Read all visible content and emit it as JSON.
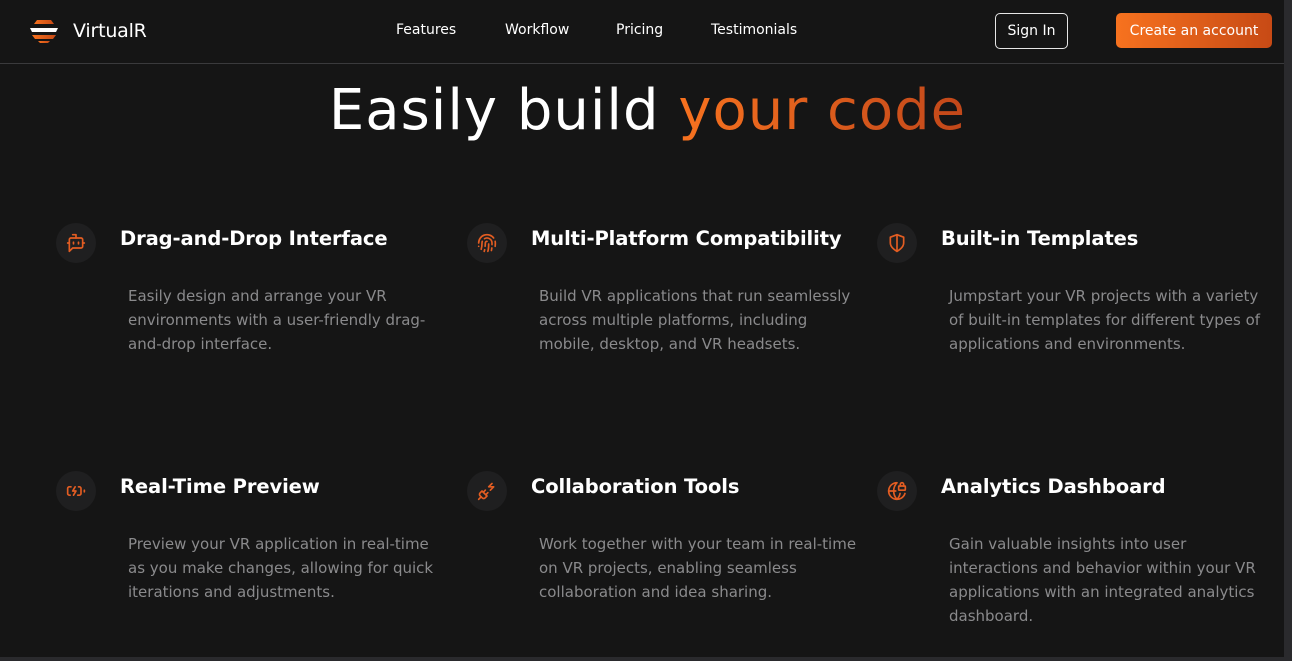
{
  "brand": {
    "name": "VirtualR",
    "logo_icon": "layered-disc-logo",
    "logo_color": "#f7721f"
  },
  "nav": {
    "links": [
      "Features",
      "Workflow",
      "Pricing",
      "Testimonials"
    ],
    "sign_in": "Sign In",
    "create_account": "Create an account"
  },
  "hero": {
    "title_plain": "Easily build ",
    "title_accent": "your code"
  },
  "colors": {
    "accent_start": "#f7721f",
    "accent_end": "#c1471a",
    "background": "#151515",
    "muted_text": "#8a8a8c"
  },
  "features": [
    {
      "icon": "bot-message-icon",
      "title": "Drag-and-Drop Interface",
      "description": "Easily design and arrange your VR environments with a user-friendly drag-and-drop interface."
    },
    {
      "icon": "fingerprint-icon",
      "title": "Multi-Platform Compatibility",
      "description": "Build VR applications that run seamlessly across multiple platforms, including mobile, desktop, and VR headsets."
    },
    {
      "icon": "shield-half-icon",
      "title": "Built-in Templates",
      "description": "Jumpstart your VR projects with a variety of built-in templates for different types of applications and environments."
    },
    {
      "icon": "battery-charging-icon",
      "title": "Real-Time Preview",
      "description": "Preview your VR application in real-time as you make changes, allowing for quick iterations and adjustments."
    },
    {
      "icon": "plug-zap-icon",
      "title": "Collaboration Tools",
      "description": "Work together with your team in real-time on VR projects, enabling seamless collaboration and idea sharing."
    },
    {
      "icon": "globe-lock-icon",
      "title": "Analytics Dashboard",
      "description": "Gain valuable insights into user interactions and behavior within your VR applications with an integrated analytics dashboard."
    }
  ]
}
